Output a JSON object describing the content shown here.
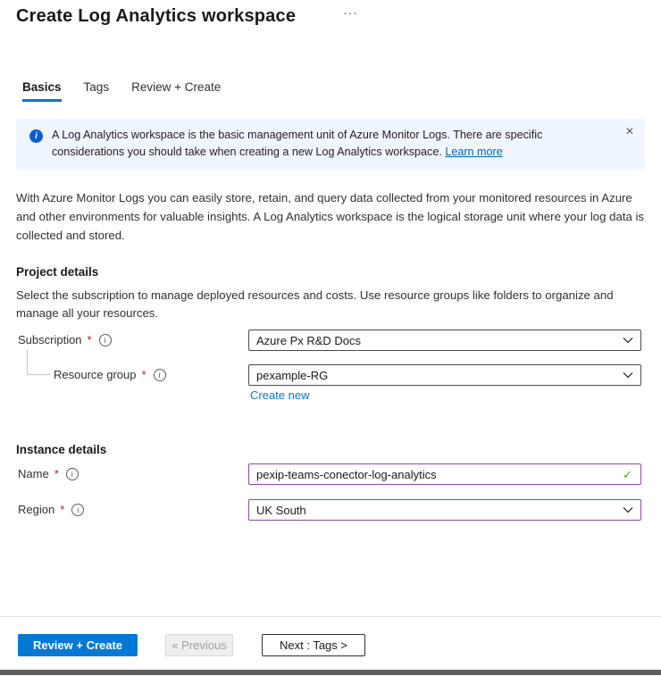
{
  "header": {
    "title": "Create Log Analytics workspace",
    "more_label": "···"
  },
  "tabs": {
    "basics": "Basics",
    "tags": "Tags",
    "review": "Review + Create"
  },
  "banner": {
    "message": "A Log Analytics workspace is the basic management unit of Azure Monitor Logs. There are specific considerations you should take when creating a new Log Analytics workspace. ",
    "link_label": "Learn more",
    "close_glyph": "✕",
    "info_glyph": "i"
  },
  "intro_text": "With Azure Monitor Logs you can easily store, retain, and query data collected from your monitored resources in Azure and other environments for valuable insights. A Log Analytics workspace is the logical storage unit where your log data is collected and stored.",
  "sections": {
    "project": {
      "heading": "Project details",
      "description": "Select the subscription to manage deployed resources and costs. Use resource groups like folders to organize and manage all your resources."
    },
    "instance": {
      "heading": "Instance details"
    }
  },
  "fields": {
    "subscription": {
      "label": "Subscription",
      "required_mark": "*",
      "info_glyph": "i",
      "value": "Azure Px R&D Docs"
    },
    "resource_group": {
      "label": "Resource group",
      "required_mark": "*",
      "info_glyph": "i",
      "value": "pexample-RG",
      "create_new_label": "Create new"
    },
    "name": {
      "label": "Name",
      "required_mark": "*",
      "info_glyph": "i",
      "value": "pexip-teams-conector-log-analytics",
      "valid_glyph": "✓"
    },
    "region": {
      "label": "Region",
      "required_mark": "*",
      "info_glyph": "i",
      "value": "UK South"
    }
  },
  "footer": {
    "review_create_label": "Review + Create",
    "previous_label": "« Previous",
    "next_label": "Next : Tags >"
  },
  "colors": {
    "accent": "#0078d4",
    "valid_border": "#8a4ba5",
    "success_check": "#57a300",
    "banner_background": "#f0f6ff",
    "required_mark": "#a4262c"
  }
}
